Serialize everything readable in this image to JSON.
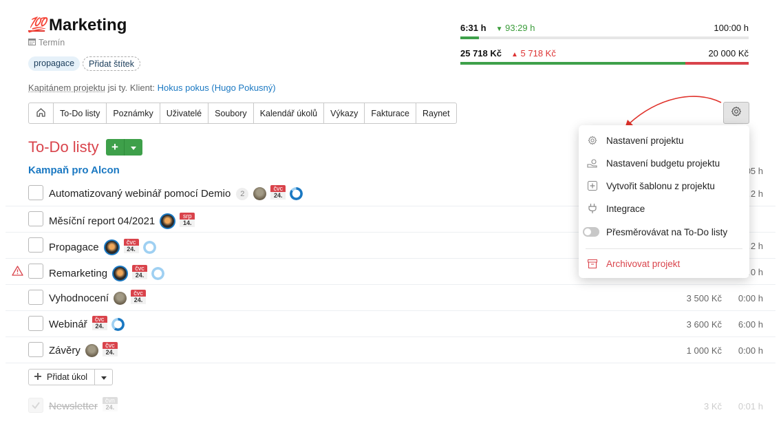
{
  "project": {
    "emoji": "💯",
    "title": "Marketing",
    "deadline_label": "Termín",
    "tags": [
      "propagace"
    ],
    "add_tag_label": "Přidat štítek",
    "captain_text_underlined": "Kapitánem projektu",
    "captain_text_rest": " jsi ty. Klient: ",
    "client_link": "Hokus pokus (Hugo Pokusný)"
  },
  "budget": {
    "time_spent": "6:31 h",
    "time_remaining": "93:29 h",
    "time_total": "100:00 h",
    "time_progress": 0.065,
    "money_spent": "25 718 Kč",
    "money_over": "5 718 Kč",
    "money_total": "20 000 Kč",
    "money_progress": 1.0,
    "money_budget_fraction": 0.78,
    "colors": {
      "ok": "#3ea04a",
      "over": "#d9434b"
    }
  },
  "tabs": [
    "To-Do listy",
    "Poznámky",
    "Uživatelé",
    "Soubory",
    "Kalendář úkolů",
    "Výkazy",
    "Fakturace",
    "Raynet"
  ],
  "section": {
    "title": "To-Do listy"
  },
  "list": {
    "title": "Kampaň pro Alcon",
    "tasks": [
      {
        "name": "Automatizovaný webinář pomocí Demio",
        "comments": "2",
        "month": "čvc",
        "day": "24.",
        "amount": "",
        "hours": "…2 h",
        "progress": 0.85
      },
      {
        "name": "Měsíční report 04/2021",
        "comments": "",
        "month": "srp",
        "day": "14.",
        "amount": "",
        "hours": "",
        "progress": null
      },
      {
        "name": "Propagace",
        "comments": "",
        "month": "čvc",
        "day": "24.",
        "amount": "",
        "hours": "…2 h",
        "progress": 0.0
      },
      {
        "name": "Remarketing",
        "comments": "",
        "month": "čvc",
        "day": "24.",
        "amount": "",
        "hours": "…0 h",
        "progress": 0.0
      },
      {
        "name": "Vyhodnocení",
        "comments": "",
        "month": "čvc",
        "day": "24.",
        "amount": "3 500 Kč",
        "hours": "0:00 h",
        "progress": null
      },
      {
        "name": "Webinář",
        "comments": "",
        "month": "čvc",
        "day": "24.",
        "amount": "3 600 Kč",
        "hours": "6:00 h",
        "progress": 0.6
      },
      {
        "name": "Závěry",
        "comments": "",
        "month": "čvc",
        "day": "24.",
        "amount": "1 000 Kč",
        "hours": "0:00 h",
        "progress": null
      }
    ],
    "add_task_label": "Přidat úkol",
    "done_task": {
      "name": "Newsletter",
      "month": "čvn",
      "day": "24.",
      "amount": "3 Kč",
      "hours": "0:01 h"
    },
    "first_row_hours_partial": "…05 h"
  },
  "menu": {
    "items": [
      {
        "label": "Nastavení projektu",
        "icon": "gear-icon"
      },
      {
        "label": "Nastavení budgetu projektu",
        "icon": "money-hand-icon"
      },
      {
        "label": "Vytvořit šablonu z projektu",
        "icon": "plus-square-icon"
      },
      {
        "label": "Integrace",
        "icon": "plug-icon"
      },
      {
        "label": "Přesměrovávat na To-Do listy",
        "icon": "toggle-icon"
      },
      {
        "label": "Archivovat projekt",
        "icon": "archive-icon"
      }
    ]
  }
}
